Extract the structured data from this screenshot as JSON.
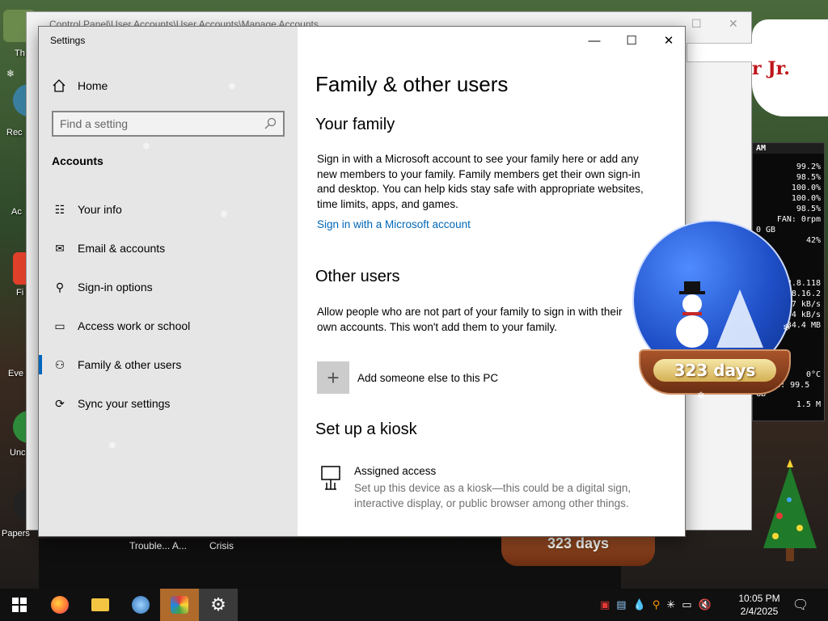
{
  "desktop": {
    "icon_labels": [
      "Th",
      "Rec",
      "Ac",
      "Fi",
      "Eve",
      "Unc",
      "Papers"
    ],
    "bg_app_labels": [
      "Trouble... A...",
      "Crisis"
    ],
    "banner_text": "r Jr.",
    "globe_days": "323 days",
    "globe_days_2": "323 days",
    "background_window": {
      "title": "Control Panel\\User Accounts\\User Accounts\\Manage Accounts"
    },
    "hw_monitor": {
      "header": "AM",
      "rows": [
        "99.2%",
        "98.5%",
        "100.0%",
        "100.0%",
        "98.5%",
        "FAN: 0rpm",
        "0 GB",
        "42%",
        "2.8.118",
        "8.16.2",
        "7 kB/s",
        "4 kB/s",
        "34.4 MB",
        "0°C",
        "Total: 99.5 GB",
        "1.5 M"
      ]
    }
  },
  "settings": {
    "window_title": "Settings",
    "sidebar": {
      "home_label": "Home",
      "search_placeholder": "Find a setting",
      "section_label": "Accounts",
      "items": [
        {
          "label": "Your info",
          "icon": "person-card-icon"
        },
        {
          "label": "Email & accounts",
          "icon": "mail-icon"
        },
        {
          "label": "Sign-in options",
          "icon": "key-icon"
        },
        {
          "label": "Access work or school",
          "icon": "briefcase-icon"
        },
        {
          "label": "Family & other users",
          "icon": "person-add-icon",
          "active": true
        },
        {
          "label": "Sync your settings",
          "icon": "sync-icon"
        }
      ]
    },
    "content": {
      "page_title": "Family & other users",
      "your_family": {
        "heading": "Your family",
        "description": "Sign in with a Microsoft account to see your family here or add any new members to your family. Family members get their own sign-in and desktop. You can help kids stay safe with appropriate websites, time limits, apps, and games.",
        "link": "Sign in with a Microsoft account"
      },
      "other_users": {
        "heading": "Other users",
        "description": "Allow people who are not part of your family to sign in with their own accounts. This won't add them to your family.",
        "add_label": "Add someone else to this PC"
      },
      "kiosk": {
        "heading": "Set up a kiosk",
        "title": "Assigned access",
        "description": "Set up this device as a kiosk—this could be a digital sign, interactive display, or public browser among other things."
      }
    }
  },
  "taskbar": {
    "time": "10:05 PM",
    "date": "2/4/2025"
  },
  "colors": {
    "accent": "#0067c0",
    "link": "#0067b8",
    "sidebar_bg": "#e6e6e6",
    "taskbar_bg": "#101010"
  }
}
